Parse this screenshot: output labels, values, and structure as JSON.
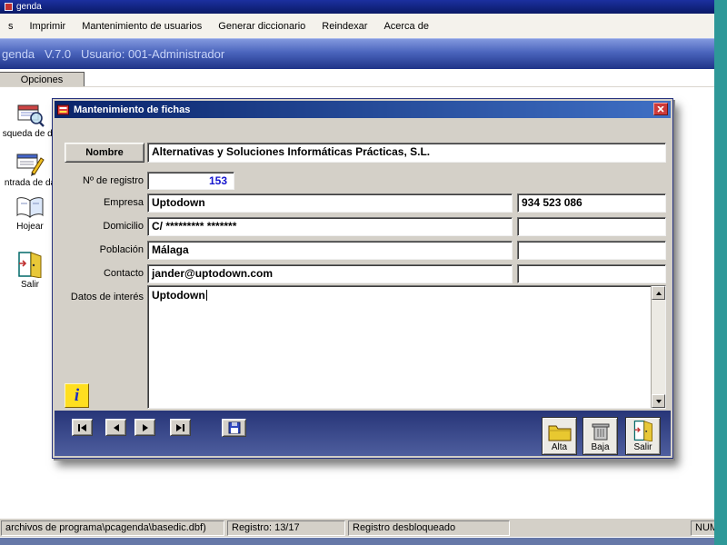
{
  "app": {
    "title": "genda",
    "menu": [
      "s",
      "Imprimir",
      "Mantenimiento de usuarios",
      "Generar diccionario",
      "Reindexar",
      "Acerca de"
    ],
    "banner": "genda   V.7.0   Usuario: 001-Administrador",
    "options_tab": "Opciones"
  },
  "sidebar": {
    "items": [
      {
        "name": "busqueda-de-datos",
        "label": "squeda de da"
      },
      {
        "name": "entrada-de-datos",
        "label": "ntrada de da"
      },
      {
        "name": "hojear",
        "label": "Hojear"
      },
      {
        "name": "salir",
        "label": "Salir"
      }
    ]
  },
  "dialog": {
    "title": "Mantenimiento de fichas",
    "fields": {
      "nombre": {
        "label": "Nombre",
        "value": "Alternativas y Soluciones Informáticas Prácticas, S.L."
      },
      "num_registro": {
        "label": "Nº de registro",
        "value": "153"
      },
      "empresa": {
        "label": "Empresa",
        "value": "Uptodown",
        "extra": "934 523 086"
      },
      "domicilio": {
        "label": "Domicilio",
        "value": "C/ ********* *******",
        "extra": ""
      },
      "poblacion": {
        "label": "Población",
        "value": "Málaga",
        "extra": ""
      },
      "contacto": {
        "label": "Contacto",
        "value": "jander@uptodown.com",
        "extra": ""
      },
      "datos_interes": {
        "label": "Datos de interés",
        "value": "Uptodown"
      }
    },
    "info_label": "i",
    "actions": {
      "alta": "Alta",
      "baja": "Baja",
      "salir": "Salir"
    }
  },
  "statusbar": {
    "path": "archivos de programa\\pcagenda\\basedic.dbf)",
    "record": "Registro: 13/17",
    "state": "Registro desbloqueado",
    "num_lock": "NUM"
  },
  "colors": {
    "desktop": "#2E9898",
    "dialog_titlebar": "#0A246A",
    "registro_value": "#1515CE",
    "info_bg": "#FFDF20"
  }
}
